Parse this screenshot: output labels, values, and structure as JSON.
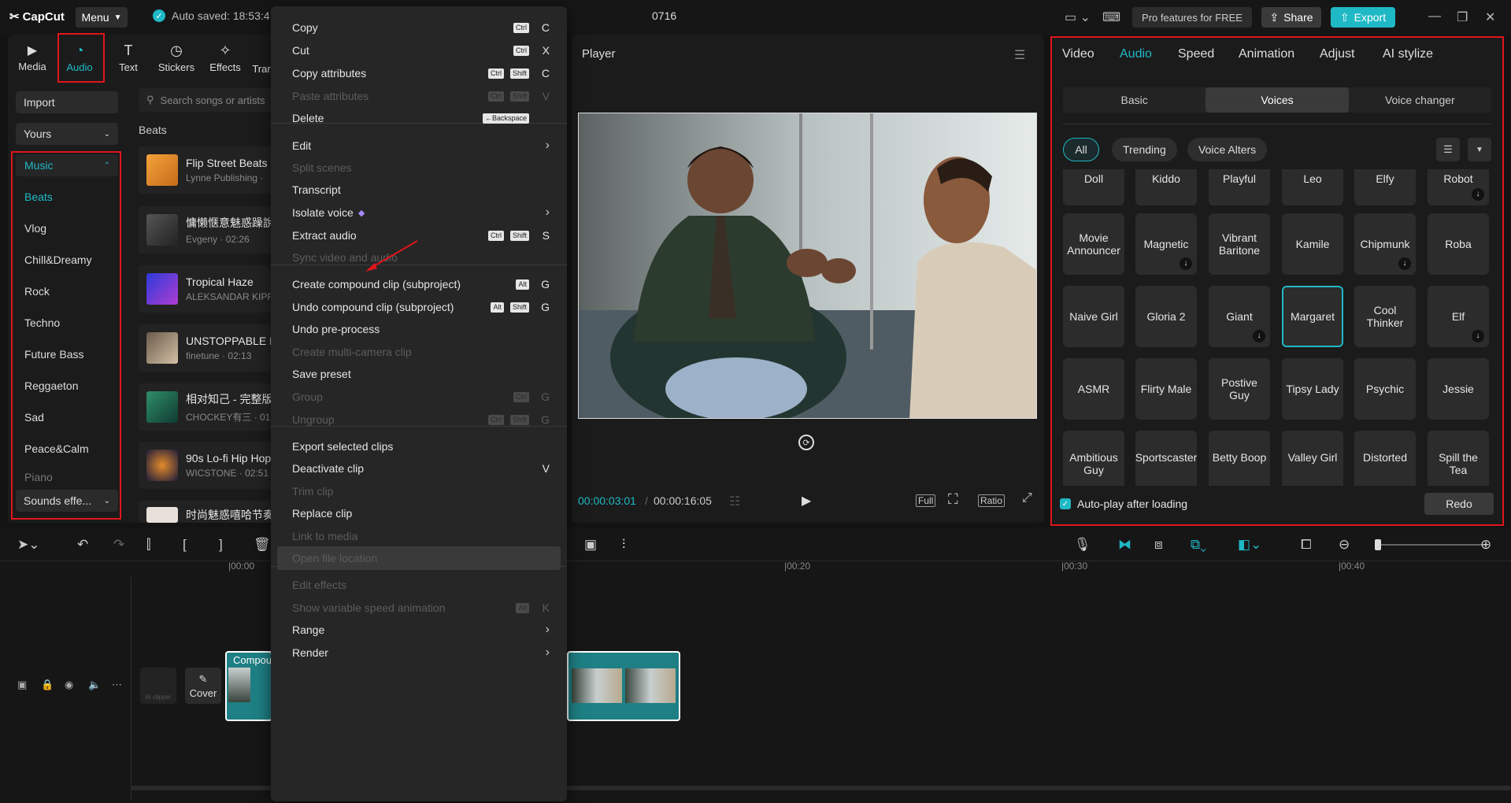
{
  "app": {
    "name": "CapCut",
    "menu_label": "Menu",
    "autosave": "Auto saved: 18:53:4",
    "project_name": "0716",
    "pro_label": "Pro features for FREE",
    "share_label": "Share",
    "export_label": "Export"
  },
  "tools": [
    {
      "label": "Media"
    },
    {
      "label": "Audio"
    },
    {
      "label": "Text"
    },
    {
      "label": "Stickers"
    },
    {
      "label": "Effects"
    },
    {
      "label": "Trar"
    }
  ],
  "library": {
    "import_label": "Import",
    "yours_label": "Yours",
    "sounds_label": "Sounds effe...",
    "categories": [
      "Music",
      "Beats",
      "Vlog",
      "Chill&Dreamy",
      "Rock",
      "Techno",
      "Future Bass",
      "Reggaeton",
      "Sad",
      "Peace&Calm",
      "Piano"
    ],
    "search_placeholder": "Search songs or artists",
    "section_label": "Beats",
    "songs": [
      {
        "title": "Flip Street Beats",
        "sub": "Lynne Publishing ·"
      },
      {
        "title": "慵懒惬意魅惑躁說",
        "sub": "Evgeny · 02:26"
      },
      {
        "title": "Tropical Haze",
        "sub": "ALEKSANDAR KIPR"
      },
      {
        "title": "UNSTOPPABLE E",
        "sub": "finetune · 02:13"
      },
      {
        "title": "相对知己 - 完整版",
        "sub": "CHOCKEY有三 · 01"
      },
      {
        "title": "90s Lo-fi Hip Hop",
        "sub": "WICSTONE · 02:51"
      },
      {
        "title": "时尚魅惑嘻哈节奏",
        "sub": ""
      }
    ]
  },
  "context_menu": [
    {
      "label": "Copy",
      "keys": [
        "Ctrl"
      ],
      "key": "C",
      "disabled": false
    },
    {
      "label": "Cut",
      "keys": [
        "Ctrl"
      ],
      "key": "X",
      "disabled": false
    },
    {
      "label": "Copy attributes",
      "keys": [
        "Ctrl",
        "Shift"
      ],
      "key": "C",
      "disabled": false
    },
    {
      "label": "Paste attributes",
      "keys": [
        "Ctrl",
        "Shift"
      ],
      "key": "V",
      "disabled": true
    },
    {
      "label": "Delete",
      "keys": [
        "←Backspace"
      ],
      "key": "",
      "disabled": false
    },
    {
      "label": "Edit",
      "submenu": true,
      "disabled": false
    },
    {
      "label": "Split scenes",
      "disabled": true
    },
    {
      "label": "Transcript",
      "disabled": false
    },
    {
      "label": "Isolate voice",
      "submenu": true,
      "pro": true,
      "disabled": false
    },
    {
      "label": "Extract audio",
      "keys": [
        "Ctrl",
        "Shift"
      ],
      "key": "S",
      "disabled": false
    },
    {
      "label": "Sync video and audio",
      "disabled": true
    },
    {
      "label": "Create compound clip (subproject)",
      "keys": [
        "Alt"
      ],
      "key": "G",
      "disabled": false
    },
    {
      "label": "Undo compound clip (subproject)",
      "keys": [
        "Alt",
        "Shift"
      ],
      "key": "G",
      "disabled": false
    },
    {
      "label": "Undo pre-process",
      "disabled": false
    },
    {
      "label": "Create multi-camera clip",
      "disabled": true
    },
    {
      "label": "Save preset",
      "disabled": false
    },
    {
      "label": "Group",
      "keys": [
        "Ctrl"
      ],
      "key": "G",
      "disabled": true
    },
    {
      "label": "Ungroup",
      "keys": [
        "Ctrl",
        "Shift"
      ],
      "key": "G",
      "disabled": true
    },
    {
      "label": "Export selected clips",
      "disabled": false
    },
    {
      "label": "Deactivate clip",
      "key": "V",
      "disabled": false
    },
    {
      "label": "Trim clip",
      "disabled": true
    },
    {
      "label": "Replace clip",
      "disabled": false
    },
    {
      "label": "Link to media",
      "disabled": true
    },
    {
      "label": "Open file location",
      "disabled": true,
      "highlight": true
    },
    {
      "label": "Edit effects",
      "disabled": true
    },
    {
      "label": "Show variable speed animation",
      "keys": [
        "Alt"
      ],
      "key": "K",
      "disabled": true
    },
    {
      "label": "Range",
      "submenu": true,
      "disabled": false
    },
    {
      "label": "Render",
      "submenu": true,
      "disabled": false
    }
  ],
  "player": {
    "title": "Player",
    "timecode_current": "00:00:03:01",
    "timecode_total": "00:00:16:05",
    "full_label": "Full",
    "ratio_label": "Ratio"
  },
  "inspector": {
    "tabs": [
      "Video",
      "Audio",
      "Speed",
      "Animation",
      "Adjust",
      "AI stylize"
    ],
    "subtabs": [
      "Basic",
      "Voices",
      "Voice changer"
    ],
    "chips": [
      "All",
      "Trending",
      "Voice Alters"
    ],
    "voices": [
      {
        "name": "Doll"
      },
      {
        "name": "Kiddo"
      },
      {
        "name": "Playful"
      },
      {
        "name": "Leo"
      },
      {
        "name": "Elfy"
      },
      {
        "name": "Robot",
        "download": true
      },
      {
        "name": "Movie Announcer"
      },
      {
        "name": "Magnetic",
        "download": true
      },
      {
        "name": "Vibrant Baritone"
      },
      {
        "name": "Kamile"
      },
      {
        "name": "Chipmunk",
        "download": true
      },
      {
        "name": "Roba"
      },
      {
        "name": "Naive Girl"
      },
      {
        "name": "Gloria 2"
      },
      {
        "name": "Giant",
        "download": true
      },
      {
        "name": "Margaret",
        "selected": true
      },
      {
        "name": "Cool Thinker"
      },
      {
        "name": "Elf",
        "download": true
      },
      {
        "name": "ASMR"
      },
      {
        "name": "Flirty Male"
      },
      {
        "name": "Postive Guy"
      },
      {
        "name": "Tipsy Lady"
      },
      {
        "name": "Psychic"
      },
      {
        "name": "Jessie"
      },
      {
        "name": "Ambitious Guy"
      },
      {
        "name": "Sportscaster"
      },
      {
        "name": "Betty Boop"
      },
      {
        "name": "Valley Girl"
      },
      {
        "name": "Distorted"
      },
      {
        "name": "Spill the Tea"
      }
    ],
    "autoplay_label": "Auto-play after loading",
    "redo_label": "Redo"
  },
  "timeline": {
    "ruler": [
      "|00:00",
      "|00:20",
      "|00:30",
      "|00:40"
    ],
    "cover_label": "Cover",
    "clipper_label": "AI clipper",
    "clip_label": "Compou"
  }
}
